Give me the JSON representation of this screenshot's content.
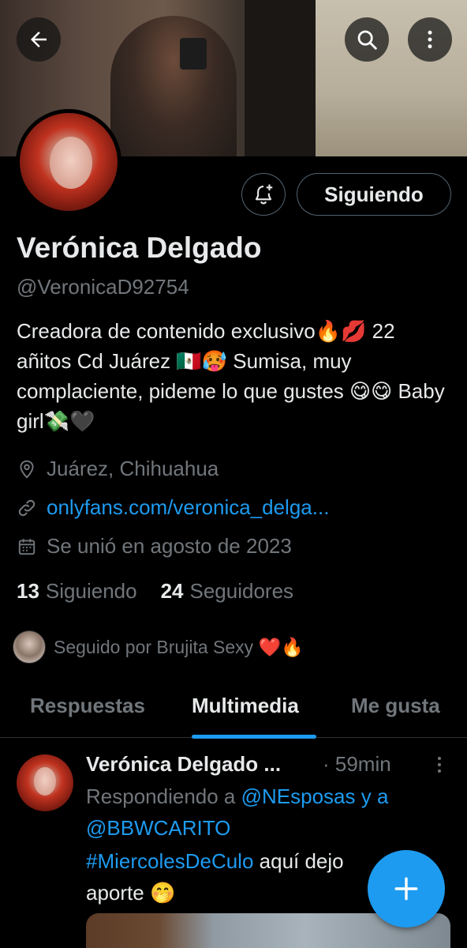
{
  "profile": {
    "name": "Verónica Delgado",
    "handle": "@VeronicaD92754",
    "bio": "Creadora de contenido exclusivo🔥💋 22 añitos Cd Juárez 🇲🇽🥵 Sumisa, muy complaciente, pideme lo que gustes 😋😋 Baby girl💸🖤",
    "location": "Juárez, Chihuahua",
    "website": "onlyfans.com/veronica_delga...",
    "joined": "Se unió en agosto de 2023",
    "following_count": "13",
    "following_label": "Siguiendo",
    "followers_count": "24",
    "followers_label": "Seguidores",
    "followed_by": "Seguido por Brujita Sexy ❤️🔥"
  },
  "actions": {
    "follow_state_label": "Siguiendo"
  },
  "tabs": [
    {
      "label": "Respuestas",
      "active": false
    },
    {
      "label": "Multimedia",
      "active": true
    },
    {
      "label": "Me gusta",
      "active": false
    }
  ],
  "tweet": {
    "author": "Verónica Delgado ...",
    "time": "· 59min",
    "reply_prefix": "Respondiendo a ",
    "reply_user1": "@NEsposas",
    "reply_and": " y a",
    "reply_user2": "@BBWCARITO",
    "hashtag": "#MiercolesDeCulo",
    "text_after_hashtag": " aquí dejo",
    "text_line3": "aporte 🤭"
  },
  "icons": {
    "back": "back-arrow-icon",
    "search": "search-icon",
    "more": "more-vertical-icon",
    "bell": "notification-bell-add-icon",
    "location": "location-pin-icon",
    "link": "link-icon",
    "calendar": "calendar-icon",
    "compose": "plus-icon"
  },
  "colors": {
    "accent": "#1d9bf0",
    "background": "#000000",
    "secondary_text": "#71767b"
  }
}
